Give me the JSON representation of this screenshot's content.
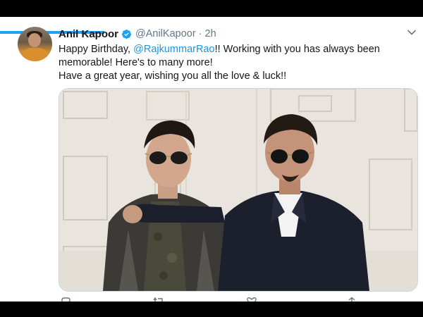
{
  "tweet": {
    "author": {
      "name": "Anil Kapoor",
      "handle": "@AnilKapoor",
      "verified": true,
      "avatar_icon": "profile-photo"
    },
    "separator": "·",
    "time": "2h",
    "text": {
      "line1_prefix": "Happy Birthday, ",
      "mention": "@RajkummarRao",
      "line1_suffix": "!! Working with you has always been",
      "line2": "memorable! Here's to many more!",
      "line3": "Have a great year, wishing you all the love & luck!!"
    },
    "media": {
      "type": "photo"
    },
    "actions": [
      "reply-icon",
      "retweet-icon",
      "like-icon",
      "share-icon"
    ]
  },
  "colors": {
    "accent": "#1da1f2",
    "mention": "#1b95e0",
    "secondary_text": "#657786",
    "primary_text": "#14171a"
  }
}
